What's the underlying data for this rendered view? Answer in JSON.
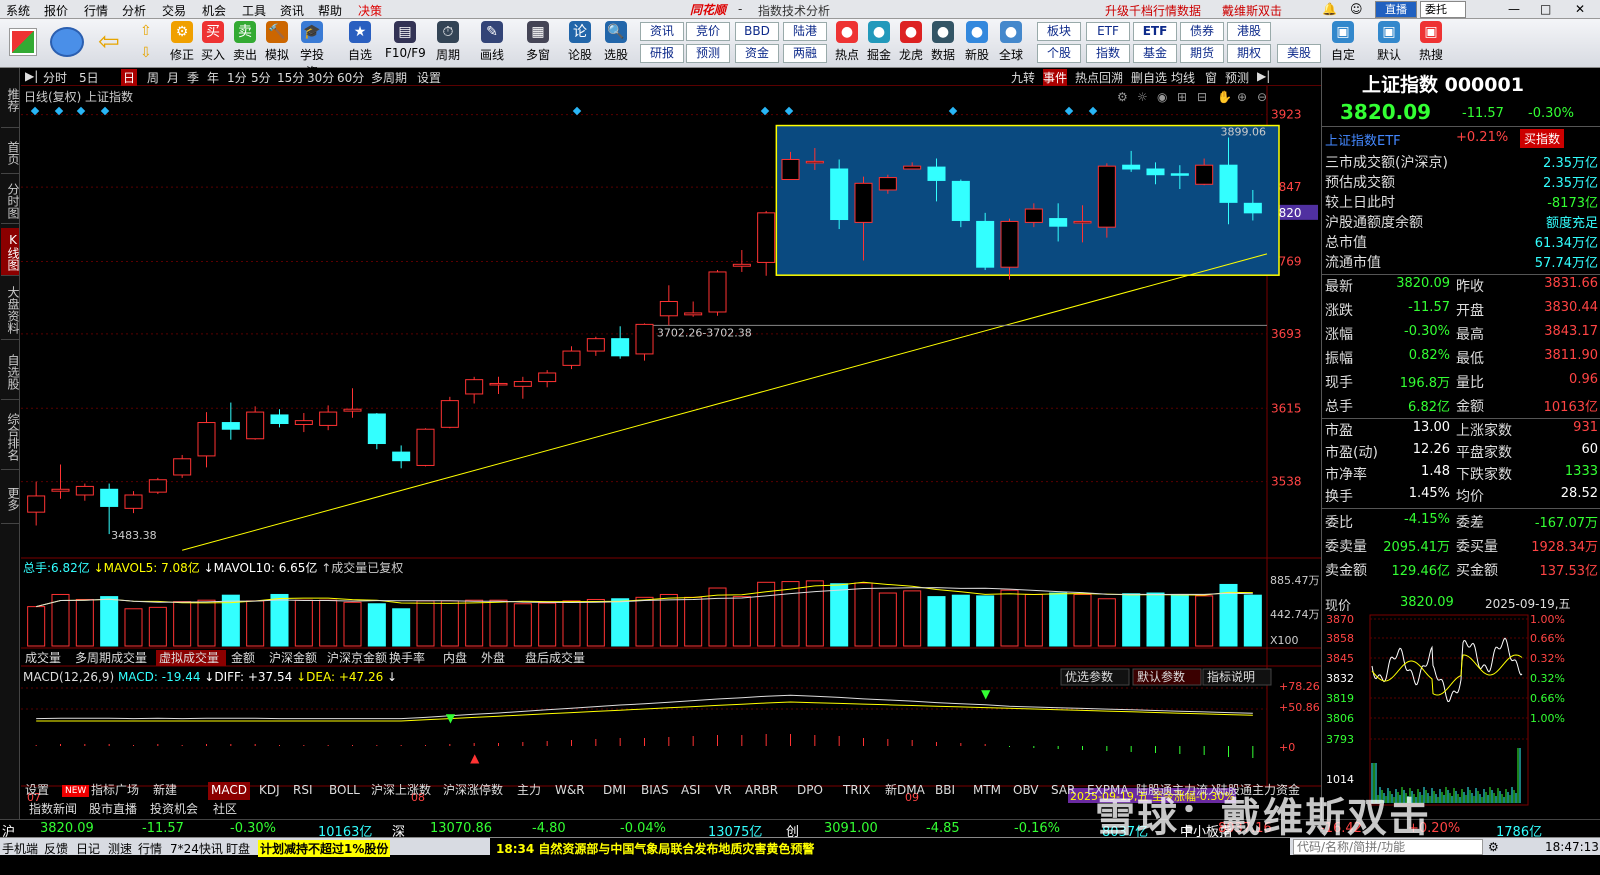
{
  "menu": {
    "items": [
      "系统",
      "报价",
      "行情",
      "分析",
      "交易",
      "机会",
      "工具",
      "资讯",
      "帮助",
      "决策"
    ],
    "brand": "同花顺",
    "separator": "-",
    "title": "指数技术分析",
    "promo1": "升级千档行情数据",
    "promo2": "戴维斯双击",
    "btn_zhibo": "直播",
    "btn_entrust": "委托"
  },
  "toolbar": {
    "buttons": [
      "修正",
      "买入",
      "卖出",
      "模拟",
      "学投资",
      "自选",
      "F10/F9",
      "周期",
      "画线",
      "多窗",
      "论股",
      "选股"
    ],
    "grid": [
      [
        "资讯",
        "竞价",
        "BBD",
        "陆港",
        "热点",
        "掘金",
        "龙虎",
        "数据",
        "新股",
        "全球"
      ],
      [
        "研报",
        "预测",
        "资金",
        "两融"
      ]
    ],
    "grid2_top": [
      "板块",
      "ETF",
      "债券",
      "港股"
    ],
    "grid2_bottom": [
      "个股",
      "指数",
      "基金",
      "期货",
      "期权",
      "美股"
    ],
    "grid2_bond": "债券",
    "right_buttons": [
      "自定",
      "默认",
      "热搜"
    ]
  },
  "leftrail": [
    "推荐",
    "首页",
    "分时图",
    "K线图",
    "大盘资料",
    "自选股",
    "综合排名",
    "更多"
  ],
  "periods": [
    "分时",
    "5日",
    "日",
    "周",
    "月",
    "季",
    "年",
    "1分",
    "5分",
    "15分",
    "30分",
    "60分",
    "多周期",
    "设置"
  ],
  "period_right": [
    "九转",
    "事件",
    "热点回溯",
    "删自选",
    "均线",
    "窗",
    "预测"
  ],
  "chart": {
    "header": "日线(复权)",
    "index_name": "上证指数",
    "high_label": "3899.06",
    "low_label": "3483.38",
    "range_label": "3702.26-3702.38",
    "price_ticks": [
      "3923",
      "3847",
      "3820",
      "3769",
      "3693",
      "3615",
      "3538"
    ],
    "vol_legend": {
      "label": "总手:",
      "total": "6.82亿",
      "ma5": "MAVOL5: 7.08亿",
      "ma10": "MAVOL10: 6.65亿",
      "note": "成交量已复权"
    },
    "vol_ticks": [
      "885.47万",
      "442.74万",
      "X100"
    ],
    "vol_tabs": [
      "成交量",
      "多周期成交量",
      "虚拟成交量",
      "金额",
      "沪深金额",
      "沪深京金额",
      "换手率",
      "内盘",
      "外盘",
      "盘后成交量"
    ],
    "macd_legend": {
      "label": "MACD(12,26,9)",
      "macd": "MACD: -19.44",
      "diff": "DIFF: +37.54",
      "dea": "DEA: +47.26"
    },
    "macd_buttons": [
      "优选参数",
      "默认参数",
      "指标说明"
    ],
    "macd_ticks": [
      "+78.26",
      "+50.86",
      "+0"
    ],
    "month_labels": [
      "07",
      "08",
      "09"
    ],
    "date_tag": "2025-09-19,五 至今涨幅-0.30%"
  },
  "chart_data": {
    "type": "candlestick",
    "title": "上证指数 日线(复权)",
    "ylim": [
      3460,
      3930
    ],
    "candles": [
      {
        "o": 3506,
        "c": 3523,
        "h": 3538,
        "l": 3492
      },
      {
        "o": 3528,
        "c": 3530,
        "h": 3556,
        "l": 3520
      },
      {
        "o": 3524,
        "c": 3533,
        "h": 3536,
        "l": 3518
      },
      {
        "o": 3530,
        "c": 3512,
        "h": 3536,
        "l": 3483
      },
      {
        "o": 3510,
        "c": 3524,
        "h": 3528,
        "l": 3505
      },
      {
        "o": 3527,
        "c": 3540,
        "h": 3542,
        "l": 3525
      },
      {
        "o": 3545,
        "c": 3562,
        "h": 3566,
        "l": 3542
      },
      {
        "o": 3565,
        "c": 3600,
        "h": 3611,
        "l": 3553
      },
      {
        "o": 3600,
        "c": 3593,
        "h": 3621,
        "l": 3582
      },
      {
        "o": 3583,
        "c": 3611,
        "h": 3617,
        "l": 3582
      },
      {
        "o": 3608,
        "c": 3599,
        "h": 3614,
        "l": 3595
      },
      {
        "o": 3598,
        "c": 3602,
        "h": 3610,
        "l": 3590
      },
      {
        "o": 3597,
        "c": 3611,
        "h": 3618,
        "l": 3592
      },
      {
        "o": 3612,
        "c": 3614,
        "h": 3636,
        "l": 3605
      },
      {
        "o": 3609,
        "c": 3578,
        "h": 3610,
        "l": 3572
      },
      {
        "o": 3569,
        "c": 3560,
        "h": 3576,
        "l": 3552
      },
      {
        "o": 3555,
        "c": 3593,
        "h": 3594,
        "l": 3554
      },
      {
        "o": 3595,
        "c": 3623,
        "h": 3627,
        "l": 3594
      },
      {
        "o": 3630,
        "c": 3645,
        "h": 3648,
        "l": 3620
      },
      {
        "o": 3640,
        "c": 3641,
        "h": 3648,
        "l": 3630
      },
      {
        "o": 3638,
        "c": 3643,
        "h": 3648,
        "l": 3625
      },
      {
        "o": 3643,
        "c": 3652,
        "h": 3655,
        "l": 3637
      },
      {
        "o": 3660,
        "c": 3675,
        "h": 3680,
        "l": 3656
      },
      {
        "o": 3675,
        "c": 3688,
        "h": 3690,
        "l": 3670
      },
      {
        "o": 3688,
        "c": 3670,
        "h": 3701,
        "l": 3667
      },
      {
        "o": 3672,
        "c": 3703,
        "h": 3704,
        "l": 3665
      },
      {
        "o": 3712,
        "c": 3727,
        "h": 3744,
        "l": 3702
      },
      {
        "o": 3713,
        "c": 3715,
        "h": 3727,
        "l": 3711
      },
      {
        "o": 3716,
        "c": 3758,
        "h": 3760,
        "l": 3712
      },
      {
        "o": 3764,
        "c": 3766,
        "h": 3781,
        "l": 3758
      },
      {
        "o": 3768,
        "c": 3820,
        "h": 3822,
        "l": 3754
      },
      {
        "o": 3855,
        "c": 3876,
        "h": 3884,
        "l": 3858
      },
      {
        "o": 3873,
        "c": 3874,
        "h": 3888,
        "l": 3865
      },
      {
        "o": 3866,
        "c": 3813,
        "h": 3876,
        "l": 3803
      },
      {
        "o": 3810,
        "c": 3851,
        "h": 3858,
        "l": 3770
      },
      {
        "o": 3844,
        "c": 3857,
        "h": 3860,
        "l": 3840
      },
      {
        "o": 3866,
        "c": 3869,
        "h": 3873,
        "l": 3867
      },
      {
        "o": 3868,
        "c": 3854,
        "h": 3877,
        "l": 3832
      },
      {
        "o": 3853,
        "c": 3812,
        "h": 3855,
        "l": 3805
      },
      {
        "o": 3811,
        "c": 3763,
        "h": 3820,
        "l": 3760
      },
      {
        "o": 3763,
        "c": 3811,
        "h": 3814,
        "l": 3750
      },
      {
        "o": 3810,
        "c": 3824,
        "h": 3830,
        "l": 3805
      },
      {
        "o": 3814,
        "c": 3806,
        "h": 3830,
        "l": 3790
      },
      {
        "o": 3810,
        "c": 3811,
        "h": 3828,
        "l": 3789
      },
      {
        "o": 3805,
        "c": 3869,
        "h": 3872,
        "l": 3794
      },
      {
        "o": 3870,
        "c": 3866,
        "h": 3885,
        "l": 3863
      },
      {
        "o": 3866,
        "c": 3860,
        "h": 3873,
        "l": 3850
      },
      {
        "o": 3861,
        "c": 3860,
        "h": 3870,
        "l": 3845
      },
      {
        "o": 3850,
        "c": 3870,
        "h": 3877,
        "l": 3849
      },
      {
        "o": 3870,
        "c": 3831,
        "h": 3899,
        "l": 3808
      },
      {
        "o": 3830,
        "c": 3820,
        "h": 3844,
        "l": 3812
      }
    ],
    "volume": [
      5.5,
      7.2,
      6.5,
      6.9,
      5.2,
      5.4,
      6.2,
      6.4,
      7.1,
      6.3,
      7.2,
      6.4,
      6.4,
      6.1,
      5.9,
      5.2,
      6.3,
      6.3,
      6.4,
      6.4,
      5.9,
      6.0,
      6.3,
      6.5,
      6.6,
      6.8,
      7.2,
      6.8,
      8.1,
      6.9,
      8.9,
      9.0,
      9.1,
      8.7,
      8.8,
      7.4,
      7.7,
      6.9,
      7.1,
      7.0,
      7.8,
      7.2,
      7.4,
      7.2,
      6.6,
      7.3,
      7.4,
      7.2,
      7.0,
      8.6,
      7.1
    ],
    "macd_hist": [
      1,
      2,
      2,
      2,
      1,
      2,
      1,
      2,
      2,
      2,
      1,
      1,
      1,
      1,
      1,
      1,
      1,
      2,
      3,
      3,
      4,
      5,
      6,
      7,
      8,
      8,
      9,
      10,
      11,
      11,
      12,
      12,
      11,
      10,
      8,
      7,
      6,
      4,
      3,
      2,
      -1,
      -2,
      -3,
      -4,
      -5,
      -6,
      -7,
      -8,
      -9,
      -11,
      -12
    ]
  },
  "right": {
    "title": "上证指数 000001",
    "price": "3820.09",
    "change": "-11.57",
    "pct": "-0.30%",
    "etf_label": "上证指数ETF",
    "etf_pct": "+0.21%",
    "buy_index": "买指数",
    "rows1": [
      {
        "k": "三市成交额(沪深京)",
        "v": "2.35万亿"
      },
      {
        "k": "预估成交额",
        "v": "2.35万亿"
      },
      {
        "k": "较上日此时",
        "v": "-8173亿"
      },
      {
        "k": "沪股通额度余额",
        "v": "额度充足"
      },
      {
        "k": "总市值",
        "v": "61.34万亿"
      },
      {
        "k": "流通市值",
        "v": "57.74万亿"
      }
    ],
    "rows2": [
      {
        "k1": "最新",
        "v1": "3820.09",
        "k2": "昨收",
        "v2": "3831.66"
      },
      {
        "k1": "涨跌",
        "v1": "-11.57",
        "k2": "开盘",
        "v2": "3830.44"
      },
      {
        "k1": "涨幅",
        "v1": "-0.30%",
        "k2": "最高",
        "v2": "3843.17"
      },
      {
        "k1": "振幅",
        "v1": "0.82%",
        "k2": "最低",
        "v2": "3811.90"
      },
      {
        "k1": "现手",
        "v1": "196.8万",
        "k2": "量比",
        "v2": "0.96"
      },
      {
        "k1": "总手",
        "v1": "6.82亿",
        "k2": "金额",
        "v2": "10163亿"
      }
    ],
    "rows3": [
      {
        "k1": "市盈",
        "v1": "13.00",
        "k2": "上涨家数",
        "v2": "931"
      },
      {
        "k1": "市盈(动)",
        "v1": "12.26",
        "k2": "平盘家数",
        "v2": "60"
      },
      {
        "k1": "市净率",
        "v1": "1.48",
        "k2": "下跌家数",
        "v2": "1333"
      },
      {
        "k1": "换手",
        "v1": "1.45%",
        "k2": "均价",
        "v2": "28.52"
      }
    ],
    "rows4": [
      {
        "k1": "委比",
        "v1": "-4.15%",
        "k2": "委差",
        "v2": "-167.07万"
      },
      {
        "k1": "委卖量",
        "v1": "2095.41万",
        "k2": "委买量",
        "v2": "1928.34万"
      },
      {
        "k1": "卖金额",
        "v1": "129.46亿",
        "k2": "买金额",
        "v2": "137.53亿"
      }
    ],
    "mini_header": {
      "label": "现价",
      "price": "3820.09",
      "date": "2025-09-19,五"
    },
    "mini_left_ticks": [
      "3870",
      "3858",
      "3845",
      "3832",
      "3819",
      "3806",
      "3793",
      "1014"
    ],
    "mini_right_ticks": [
      "1.00%",
      "0.66%",
      "0.32%",
      "0.32%",
      "0.66%",
      "1.00%"
    ]
  },
  "bottom_tabs": [
    "设置",
    "NEW",
    "指标广场",
    "新建",
    "MACD",
    "KDJ",
    "RSI",
    "BOLL",
    "沪深上涨数",
    "沪深涨停数",
    "主力",
    "W&R",
    "DMI",
    "BIAS",
    "ASI",
    "VR",
    "ARBR",
    "DPO",
    "TRIX",
    "新DMA",
    "BBI",
    "MTM",
    "OBV",
    "SAR",
    "EXPMA",
    "陆股通主力流入",
    "陆股通主力资金"
  ],
  "news_tabs": [
    "指数新闻",
    "股市直播",
    "投资机会",
    "社区"
  ],
  "indexbar": {
    "sh": {
      "name": "沪",
      "price": "3820.09",
      "chg": "-11.57",
      "pct": "-0.30%",
      "amt": "10163亿"
    },
    "sz": {
      "name": "深",
      "price": "13070.86",
      "chg": "-4.80",
      "pct": "-0.04%",
      "amt": "13075亿"
    },
    "cy": {
      "name": "创",
      "price": "3091.00",
      "chg": "-4.85",
      "pct": "-0.16%",
      "amt": "8037亿"
    },
    "kc": {
      "name": "中小板指",
      "price": "8037.16",
      "chg": "-16.42",
      "pct": "+0.20%",
      "amt": "1786亿"
    }
  },
  "statusbar": {
    "items": [
      "手机端",
      "反馈",
      "日记",
      "测速",
      "行情",
      "7*24快讯",
      "盯盘"
    ],
    "ticker1": "计划减持不超过1%股份",
    "ticker2": "18:34 自然资源部与中国气象局联合发布地质灾害黄色预警",
    "search_placeholder": "代码/名称/简拼/功能",
    "time": "18:47:13"
  },
  "watermark": "雪球：戴维斯双击",
  "colors": {
    "up": "#ff3333",
    "down": "#33ffff",
    "ma": "#ffff00",
    "bg": "#000000"
  }
}
